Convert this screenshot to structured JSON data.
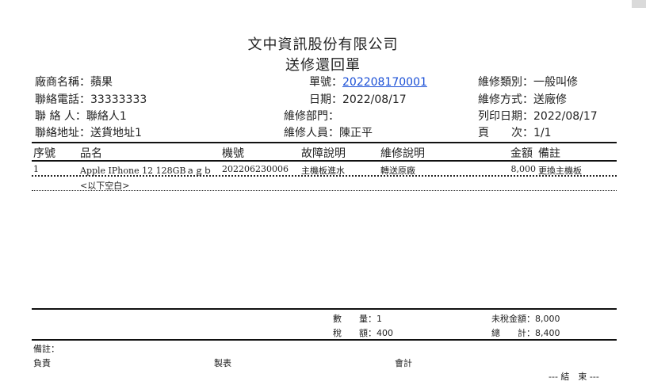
{
  "document": {
    "company": "文中資訊股份有限公司",
    "title": "送修還回單"
  },
  "header": {
    "vendor_label": "廠商名稱：",
    "vendor_value": "蘋果",
    "phone_label": "聯絡電話：",
    "phone_value": "33333333",
    "contact_label": "聯 絡 人：",
    "contact_value": "聯絡人1",
    "address_label": "聯絡地址：",
    "address_value": "送貨地址1",
    "order_label": "單號：",
    "order_value": "202208170001",
    "date_label": "日期：",
    "date_value": "2022/08/17",
    "dept_label": "維修部門：",
    "dept_value": "",
    "staff_label": "維修人員：",
    "staff_value": "陳正平",
    "repair_type_label": "維修類別：",
    "repair_type_value": "一般叫修",
    "repair_method_label": "維修方式：",
    "repair_method_value": "送廠修",
    "print_date_label": "列印日期：",
    "print_date_value": "2022/08/17",
    "page_label": "頁　　次：",
    "page_value": "1/1"
  },
  "table": {
    "columns": {
      "seq": "序號",
      "name": "品名",
      "model": "機號",
      "fault": "故障說明",
      "repair": "維修說明",
      "amount": "金額",
      "note": "備註"
    },
    "rows": [
      {
        "seq": "1",
        "name": "Apple IPhone 12 128GBａｇｂ",
        "model": "202206230006",
        "fault": "主機板進水",
        "repair": "轉送原廠",
        "amount": "8,000",
        "note": "更換主機板"
      }
    ],
    "blank_note": "<以下空白>"
  },
  "footer": {
    "qty_label": "數　　量：",
    "qty_value": "1",
    "tax_label": "稅　　額：",
    "tax_value": "400",
    "pretax_label": "未稅金額：",
    "pretax_value": "8,000",
    "total_label": "總　　計：",
    "total_value": "8,400",
    "remarks_label": "備註：",
    "sign_responsible": "負責",
    "sign_maker": "製表",
    "sign_accounting": "會計",
    "end_mark": "--- 結　束 ---"
  }
}
